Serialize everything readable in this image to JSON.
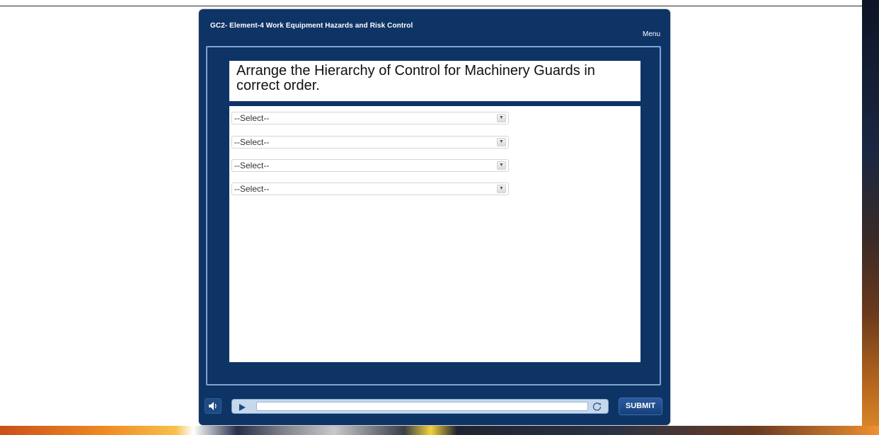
{
  "course": {
    "title": "GC2- Element-4 Work Equipment Hazards and Risk Control",
    "menu_label": "Menu"
  },
  "question": {
    "text": "Arrange the Hierarchy of Control for Machinery Guards in correct order."
  },
  "dropdowns": [
    {
      "selected": "--Select--"
    },
    {
      "selected": "--Select--"
    },
    {
      "selected": "--Select--"
    },
    {
      "selected": "--Select--"
    }
  ],
  "controls": {
    "submit_label": "SUBMIT",
    "progress": 0
  },
  "icons": {
    "volume": "speaker-icon",
    "play": "play-icon",
    "replay": "replay-icon",
    "dropdown_arrow": "chevron-down-icon"
  },
  "colors": {
    "player_bg": "#0e3466",
    "stage_border": "#7fa4d4",
    "seekbar_bg": "#c6d8ec"
  }
}
